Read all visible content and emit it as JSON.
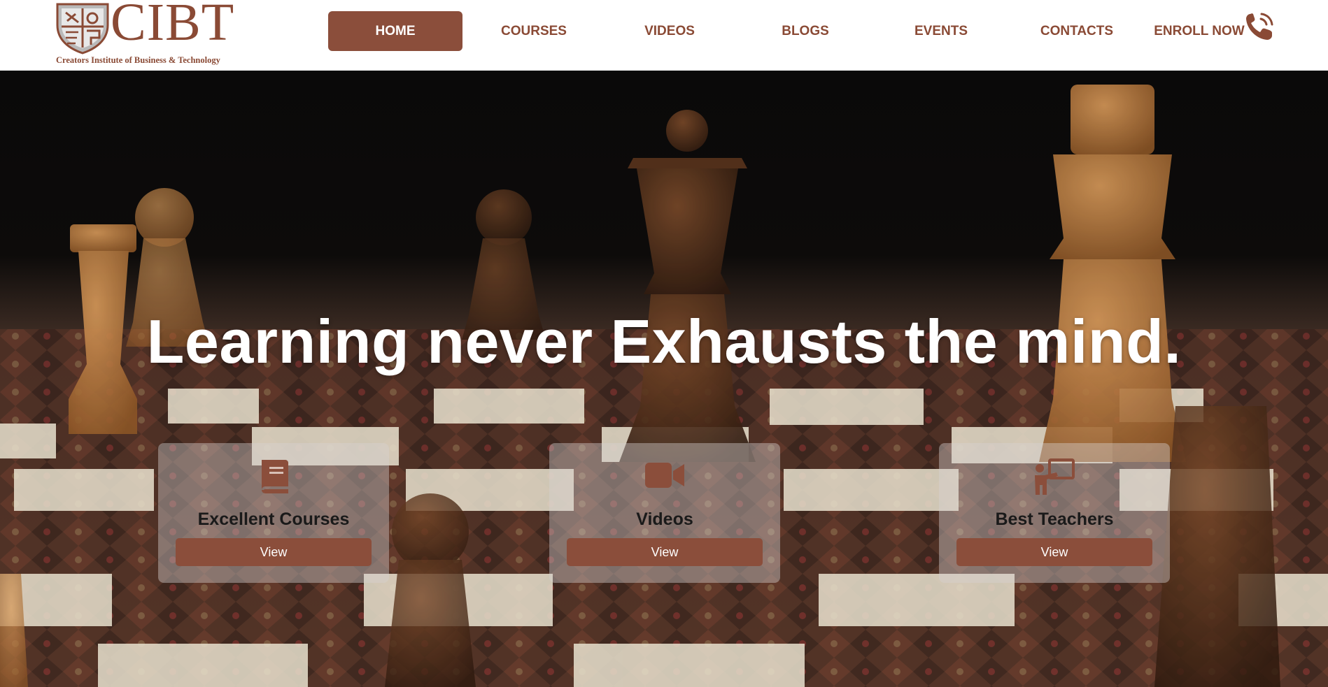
{
  "brand": {
    "name": "CIBT",
    "tagline": "Creators Institute of Business & Technology",
    "color": "#8a4a35"
  },
  "nav": {
    "items": [
      {
        "label": "HOME",
        "active": true
      },
      {
        "label": "COURSES",
        "active": false
      },
      {
        "label": "VIDEOS",
        "active": false
      },
      {
        "label": "BLOGS",
        "active": false
      },
      {
        "label": "EVENTS",
        "active": false
      },
      {
        "label": "CONTACTS",
        "active": false
      },
      {
        "label": "ENROLL NOW",
        "active": false
      }
    ],
    "phone_icon": "phone-icon",
    "accent": "#8b4e3b"
  },
  "hero": {
    "headline": "Learning never Exhausts the mind.",
    "background": "chess-board-photo"
  },
  "cards": [
    {
      "title": "Excellent Courses",
      "icon": "book-icon",
      "button": "View"
    },
    {
      "title": "Videos",
      "icon": "video-camera-icon",
      "button": "View"
    },
    {
      "title": "Best Teachers",
      "icon": "teacher-board-icon",
      "button": "View"
    }
  ]
}
